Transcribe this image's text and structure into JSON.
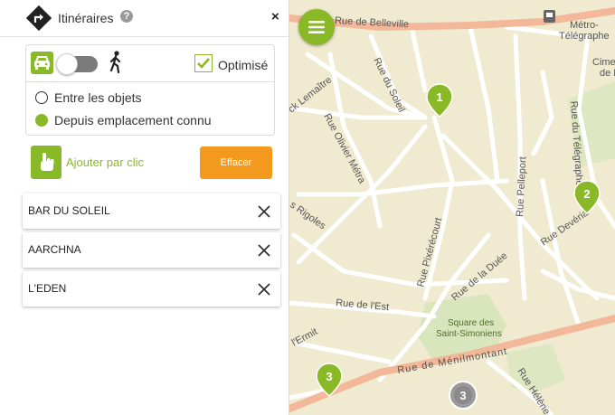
{
  "panel": {
    "title": "Itinéraires",
    "help_icon": "help-icon",
    "close_label": "×",
    "optimise_label": "Optimisé",
    "radio_between": "Entre les objets",
    "radio_known": "Depuis emplacement connu",
    "add_label": "Ajouter par clic",
    "clear_label": "Effacer",
    "items": [
      {
        "label": "BAR DU SOLEIL"
      },
      {
        "label": "AARCHNA"
      },
      {
        "label": "L'EDEN"
      }
    ]
  },
  "map": {
    "streets": [
      {
        "label": "Rue de Belleville"
      },
      {
        "label": "Métro-"
      },
      {
        "label": "Télégraphe"
      },
      {
        "label": "Cime"
      },
      {
        "label": "de Bel"
      },
      {
        "label": "ck Lemaître"
      },
      {
        "label": "Rue du Soleil"
      },
      {
        "label": "Rue Olivier Métra"
      },
      {
        "label": "Rue Pelleport"
      },
      {
        "label": "Rue du Télégraphe"
      },
      {
        "label": "Rue Devéria"
      },
      {
        "label": "s Rigoles"
      },
      {
        "label": "Rue Pixérécourt"
      },
      {
        "label": "Rue de la Duée"
      },
      {
        "label": "Rue de l'Est"
      },
      {
        "label": "Square des"
      },
      {
        "label": "Saint-Simoniens"
      },
      {
        "label": "l'Ermit"
      },
      {
        "label": "Rue de Ménilmontant"
      },
      {
        "label": "Rue Hélène J"
      }
    ],
    "markers": [
      {
        "label": "1"
      },
      {
        "label": "2"
      },
      {
        "label": "3"
      }
    ],
    "cluster_label": "3"
  },
  "colors": {
    "accent_green": "#8ab928",
    "clear_orange": "#f39a1e",
    "map_background": "#f0ead0",
    "main_road": "#f3b89a"
  }
}
